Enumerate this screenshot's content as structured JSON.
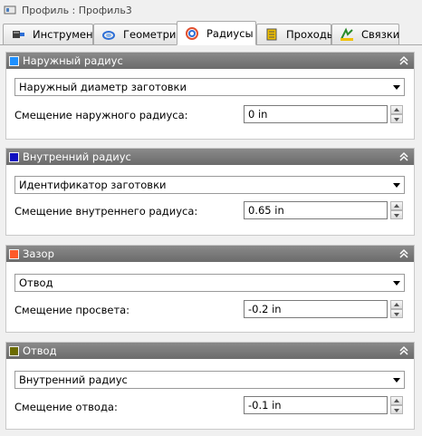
{
  "window": {
    "title": "Профиль : Профиль3"
  },
  "tabs": [
    {
      "label": "Инструмент",
      "icon": "tool-icon",
      "active": false
    },
    {
      "label": "Геометрия",
      "icon": "geometry-icon",
      "active": false
    },
    {
      "label": "Радиусы",
      "icon": "radius-icon",
      "active": true
    },
    {
      "label": "Проходы",
      "icon": "passes-icon",
      "active": false
    },
    {
      "label": "Связки",
      "icon": "links-icon",
      "active": false
    }
  ],
  "sections": {
    "outer": {
      "title": "Наружный радиус",
      "color": "#1e90ff",
      "select_value": "Наружный диаметр заготовки",
      "field_label": "Смещение наружного радиуса:",
      "field_value": "0 in"
    },
    "inner": {
      "title": "Внутренний радиус",
      "color": "#1010c0",
      "select_value": "Идентификатор заготовки",
      "field_label": "Смещение внутреннего радиуса:",
      "field_value": "0.65 in"
    },
    "clearance": {
      "title": "Зазор",
      "color": "#ff5a2a",
      "select_value": "Отвод",
      "field_label": "Смещение просвета:",
      "field_value": "-0.2 in"
    },
    "retract": {
      "title": "Отвод",
      "color": "#6b6b00",
      "select_value": "Внутренний радиус",
      "field_label": "Смещение отвода:",
      "field_value": "-0.1 in"
    }
  }
}
